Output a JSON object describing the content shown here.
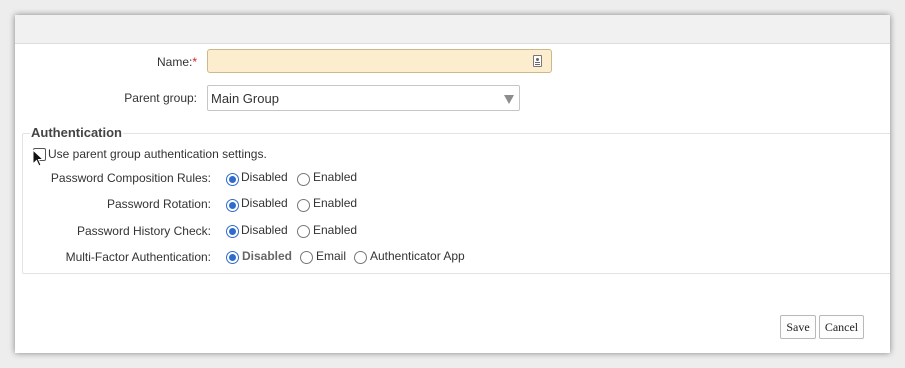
{
  "form": {
    "name_label": "Name:",
    "required_mark": "*",
    "name_value": "",
    "parent_label": "Parent group:",
    "parent_value": "Main Group"
  },
  "auth": {
    "legend": "Authentication",
    "use_parent_label": "Use parent group authentication settings.",
    "use_parent_checked": false,
    "rows": [
      {
        "label": "Password Composition Rules:",
        "options": [
          "Disabled",
          "Enabled"
        ],
        "selected": "Disabled"
      },
      {
        "label": "Password Rotation:",
        "options": [
          "Disabled",
          "Enabled"
        ],
        "selected": "Disabled"
      },
      {
        "label": "Password History Check:",
        "options": [
          "Disabled",
          "Enabled"
        ],
        "selected": "Disabled"
      },
      {
        "label": "Multi-Factor Authentication:",
        "options": [
          "Disabled",
          "Email",
          "Authenticator App"
        ],
        "selected": "Disabled"
      }
    ]
  },
  "buttons": {
    "save": "Save",
    "cancel": "Cancel"
  },
  "colors": {
    "accent": "#2f6bcc",
    "required": "#d21f1f",
    "name_field_bg": "#fbedcd"
  },
  "icons": {
    "name_field": "contact-card-icon",
    "select": "chevron-down-icon",
    "cursor": "mouse-pointer-icon"
  }
}
